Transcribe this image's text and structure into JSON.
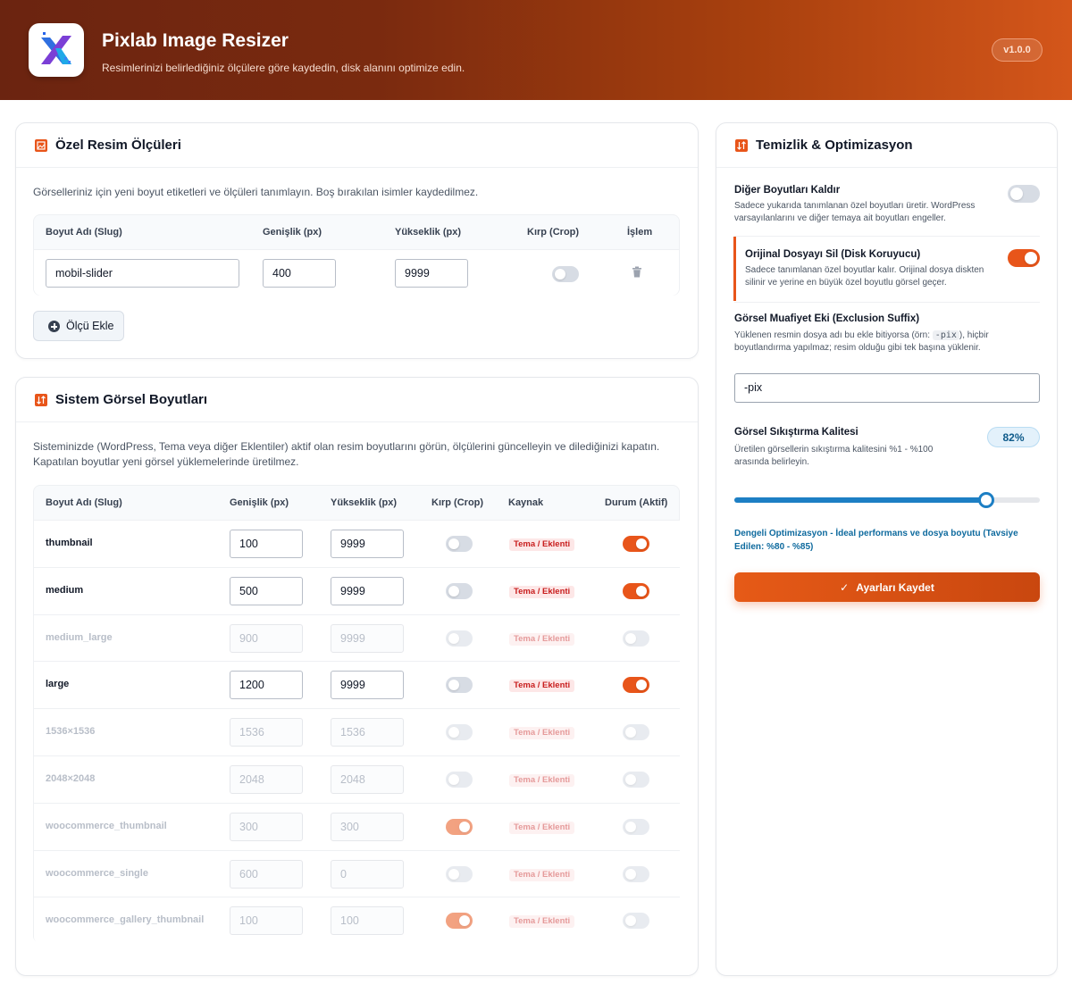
{
  "app": {
    "title": "Pixlab Image Resizer",
    "subtitle": "Resimlerinizi belirlediğiniz ölçülere göre kaydedin, disk alanını optimize edin.",
    "version": "v1.0.0"
  },
  "custom_sizes": {
    "title": "Özel Resim Ölçüleri",
    "description": "Görselleriniz için yeni boyut etiketleri ve ölçüleri tanımlayın. Boş bırakılan isimler kaydedilmez.",
    "headers": {
      "slug": "Boyut Adı (Slug)",
      "width": "Genişlik (px)",
      "height": "Yükseklik (px)",
      "crop": "Kırp (Crop)",
      "action": "İşlem"
    },
    "rows": [
      {
        "slug": "mobil-slider",
        "width": "400",
        "height": "9999",
        "crop": false
      }
    ],
    "add_button": "Ölçü Ekle"
  },
  "system_sizes": {
    "title": "Sistem Görsel Boyutları",
    "description": "Sisteminizde (WordPress, Tema veya diğer Eklentiler) aktif olan resim boyutlarını görün, ölçülerini güncelleyin ve dilediğinizi kapatın. Kapatılan boyutlar yeni görsel yüklemelerinde üretilmez.",
    "headers": {
      "slug": "Boyut Adı (Slug)",
      "width": "Genişlik (px)",
      "height": "Yükseklik (px)",
      "crop": "Kırp (Crop)",
      "source": "Kaynak",
      "status": "Durum (Aktif)"
    },
    "rows": [
      {
        "slug": "thumbnail",
        "width": "100",
        "height": "9999",
        "crop": false,
        "source": "Tema / Eklenti",
        "active": true
      },
      {
        "slug": "medium",
        "width": "500",
        "height": "9999",
        "crop": false,
        "source": "Tema / Eklenti",
        "active": true
      },
      {
        "slug": "medium_large",
        "width": "900",
        "height": "9999",
        "crop": false,
        "source": "Tema / Eklenti",
        "active": false
      },
      {
        "slug": "large",
        "width": "1200",
        "height": "9999",
        "crop": false,
        "source": "Tema / Eklenti",
        "active": true
      },
      {
        "slug": "1536×1536",
        "width": "1536",
        "height": "1536",
        "crop": false,
        "source": "Tema / Eklenti",
        "active": false
      },
      {
        "slug": "2048×2048",
        "width": "2048",
        "height": "2048",
        "crop": false,
        "source": "Tema / Eklenti",
        "active": false
      },
      {
        "slug": "woocommerce_thumbnail",
        "width": "300",
        "height": "300",
        "crop": true,
        "source": "Tema / Eklenti",
        "active": false
      },
      {
        "slug": "woocommerce_single",
        "width": "600",
        "height": "0",
        "crop": false,
        "source": "Tema / Eklenti",
        "active": false
      },
      {
        "slug": "woocommerce_gallery_thumbnail",
        "width": "100",
        "height": "100",
        "crop": true,
        "source": "Tema / Eklenti",
        "active": false
      }
    ]
  },
  "cleanup": {
    "title": "Temizlik & Optimizasyon",
    "remove_other": {
      "title": "Diğer Boyutları Kaldır",
      "description": "Sadece yukarıda tanımlanan özel boyutları üretir. WordPress varsayılanlarını ve diğer temaya ait boyutları engeller.",
      "enabled": false
    },
    "delete_original": {
      "title": "Orijinal Dosyayı Sil (Disk Koruyucu)",
      "description": "Sadece tanımlanan özel boyutlar kalır. Orijinal dosya diskten silinir ve yerine en büyük özel boyutlu görsel geçer.",
      "enabled": true
    },
    "exclusion": {
      "title": "Görsel Muafiyet Eki (Exclusion Suffix)",
      "desc_before": "Yüklenen resmin dosya adı bu ekle bitiyorsa (örn: ",
      "desc_code": "-pix",
      "desc_after": "), hiçbir boyutlandırma yapılmaz; resim olduğu gibi tek başına yüklenir.",
      "value": "-pix"
    },
    "quality": {
      "title": "Görsel Sıkıştırma Kalitesi",
      "description": "Üretilen görsellerin sıkıştırma kalitesini %1 - %100 arasında belirleyin.",
      "value_label": "82%",
      "value": 82,
      "note": "Dengeli Optimizasyon - İdeal performans ve dosya boyutu (Tavsiye Edilen: %80 - %85)"
    },
    "save_button": "Ayarları Kaydet"
  },
  "colors": {
    "accent": "#e8551a",
    "slider": "#1d7fc4"
  }
}
